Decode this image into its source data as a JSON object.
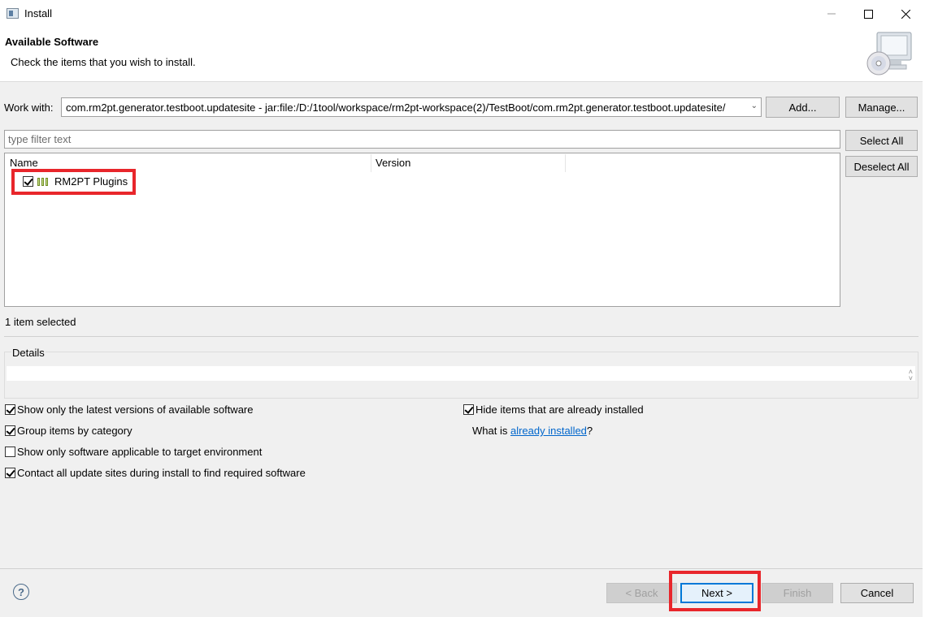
{
  "window": {
    "title": "Install"
  },
  "banner": {
    "title": "Available Software",
    "description": "Check the items that you wish to install."
  },
  "work_with": {
    "label": "Work with:",
    "value": "com.rm2pt.generator.testboot.updatesite - jar:file:/D:/1tool/workspace/rm2pt-workspace(2)/TestBoot/com.rm2pt.generator.testboot.updatesite/",
    "add_label": "Add...",
    "manage_label": "Manage..."
  },
  "filter": {
    "placeholder": "type filter text"
  },
  "selection_buttons": {
    "select_all": "Select All",
    "deselect_all": "Deselect All"
  },
  "tree": {
    "columns": [
      "Name",
      "Version"
    ],
    "items": [
      {
        "label": "RM2PT Plugins",
        "checked": true
      }
    ]
  },
  "status": "1 item selected",
  "details": {
    "label": "Details"
  },
  "options": {
    "latest_versions": "Show only the latest versions of available software",
    "group_by_category": "Group items by category",
    "applicable_only": "Show only software applicable to target environment",
    "contact_sites": "Contact all update sites during install to find required software",
    "hide_installed": "Hide items that are already installed",
    "what_is": "What is ",
    "already_installed_link": "already installed",
    "question_mark": "?"
  },
  "buttons": {
    "help": "?",
    "back": "< Back",
    "next": "Next >",
    "finish": "Finish",
    "cancel": "Cancel"
  },
  "colors": {
    "highlight": "#e8262b",
    "link": "#0066cc",
    "default_button": "#0078d7"
  }
}
